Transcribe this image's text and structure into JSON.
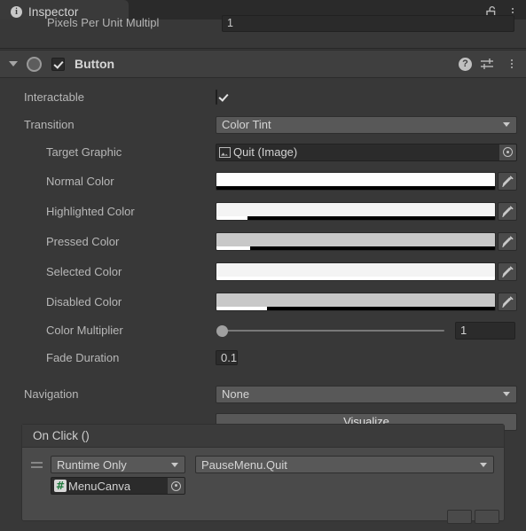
{
  "window": {
    "tab_label": "Inspector",
    "tab_icon": "info-icon",
    "lock_icon": "unlock-padlock-icon",
    "menu_icon": "kebab-menu-icon"
  },
  "clipped_row": {
    "label": "Pixels Per Unit Multipl",
    "value": "1"
  },
  "component": {
    "title": "Button",
    "enabled": true,
    "foldout_expanded": true,
    "icon": "button-component-icon",
    "help_icon": "help-question-icon",
    "preset_icon": "preset-sliders-icon",
    "menu_icon": "kebab-menu-icon"
  },
  "properties": {
    "interactable": {
      "label": "Interactable",
      "checked": true
    },
    "transition": {
      "label": "Transition",
      "value": "Color Tint"
    },
    "target_graphic": {
      "label": "Target Graphic",
      "value": "Quit (Image)",
      "icon": "image-component-icon"
    },
    "normal_color": {
      "label": "Normal Color",
      "swatch": "#ffffff",
      "alpha_pct": 0
    },
    "highlighted_color": {
      "label": "Highlighted Color",
      "swatch": "#f4f4f4",
      "alpha_pct": 11
    },
    "pressed_color": {
      "label": "Pressed Color",
      "swatch": "#c8c8c8",
      "alpha_pct": 12
    },
    "selected_color": {
      "label": "Selected Color",
      "swatch": "#f4f4f4",
      "alpha_pct": 100
    },
    "disabled_color": {
      "label": "Disabled Color",
      "swatch": "#c8c8c8",
      "alpha_pct": 18
    },
    "color_multiplier": {
      "label": "Color Multiplier",
      "value": "1",
      "slider_pct": 0
    },
    "fade_duration": {
      "label": "Fade Duration",
      "value": "0.1"
    },
    "navigation": {
      "label": "Navigation",
      "value": "None"
    },
    "visualize_button": {
      "label": "Visualize"
    }
  },
  "on_click": {
    "title": "On Click ()",
    "entries": [
      {
        "runtime_mode": "Runtime Only",
        "function": "PauseMenu.Quit",
        "target_object": "MenuCanva",
        "target_icon": "script-hash-icon"
      }
    ]
  },
  "colors": {
    "window_bg": "#383838",
    "header_bg": "#3f3f3f",
    "tabbar_bg": "#2a2a2a",
    "field_bg": "#2b2b2b",
    "dropdown_bg": "#585858",
    "label_text": "#b7b7b7",
    "value_text": "#d2d2d2",
    "box_bg": "#4a4a4a"
  }
}
